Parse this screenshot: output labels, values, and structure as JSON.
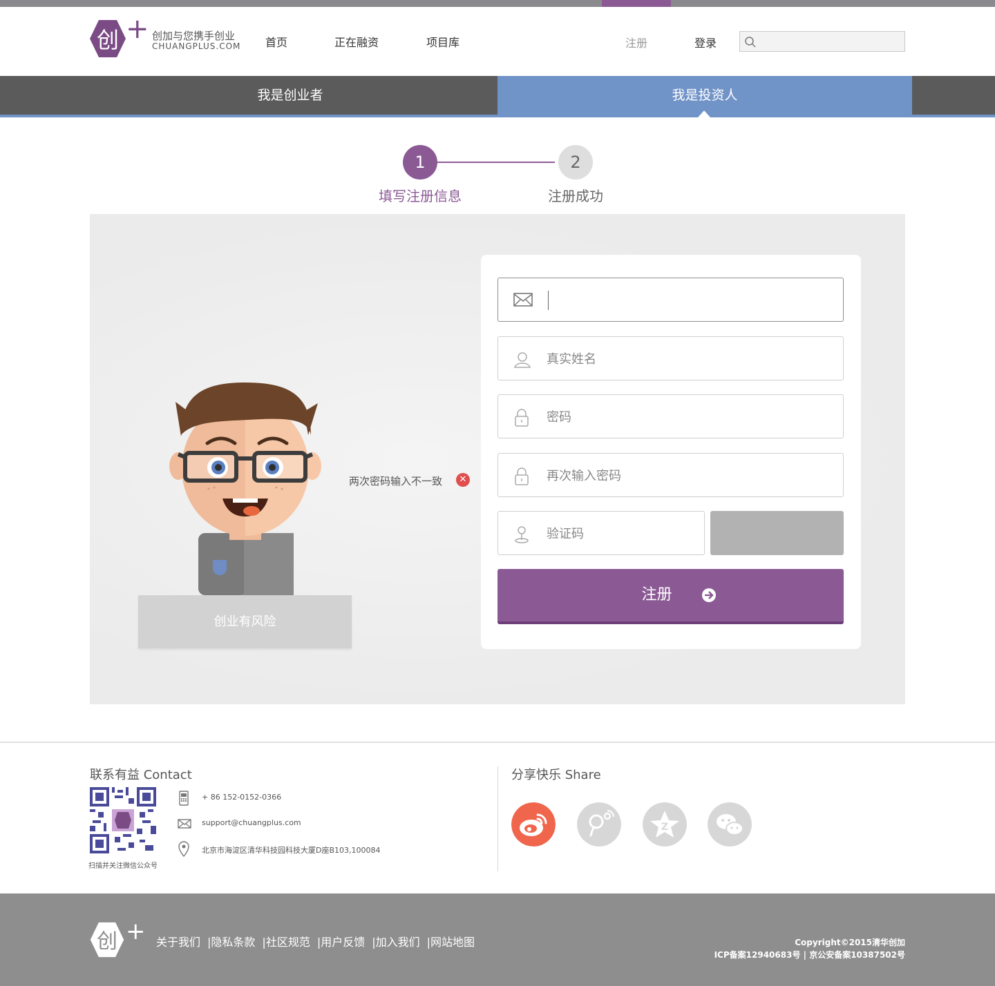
{
  "brand": {
    "logo_glyph": "创",
    "tagline": "创加与您携手创业",
    "domain": "CHUANGPLUS.COM",
    "accent_color": "#8b5a95",
    "blue_color": "#7093c8"
  },
  "nav": {
    "items": [
      {
        "label": "首页"
      },
      {
        "label": "正在融资"
      },
      {
        "label": "项目库"
      }
    ],
    "register": "注册",
    "login": "登录",
    "search_placeholder": ""
  },
  "roles": {
    "founder": "我是创业者",
    "investor": "我是投资人",
    "active": "investor"
  },
  "steps": [
    {
      "number": "1",
      "label": "填写注册信息",
      "state": "active"
    },
    {
      "number": "2",
      "label": "注册成功",
      "state": "pending"
    }
  ],
  "illustration": {
    "caption": "创业有风险"
  },
  "error": {
    "message": "两次密码输入不一致",
    "icon": "✕"
  },
  "form": {
    "email_placeholder": "",
    "name_placeholder": "真实姓名",
    "password_placeholder": "密码",
    "password_confirm_placeholder": "再次输入密码",
    "captcha_placeholder": "验证码",
    "submit_label": "注册"
  },
  "contact": {
    "title": "联系有益 Contact",
    "qr_caption": "扫描并关注微信公众号",
    "phone": "+ 86 152-0152-0366",
    "email": "support@chuangplus.com",
    "address": "北京市海淀区清华科技园科技大厦D座B103,100084"
  },
  "share": {
    "title": "分享快乐 Share",
    "icons": [
      "weibo-icon",
      "tencent-weibo-icon",
      "qzone-icon",
      "wechat-icon"
    ]
  },
  "footer": {
    "links": [
      "关于我们",
      "隐私条款",
      "社区规范",
      "用户反馈",
      "加入我们",
      "网站地图"
    ],
    "copyright": "Copyright©2015清华创加",
    "icp": "ICP备案12940683号 | 京公安备案10387502号"
  }
}
